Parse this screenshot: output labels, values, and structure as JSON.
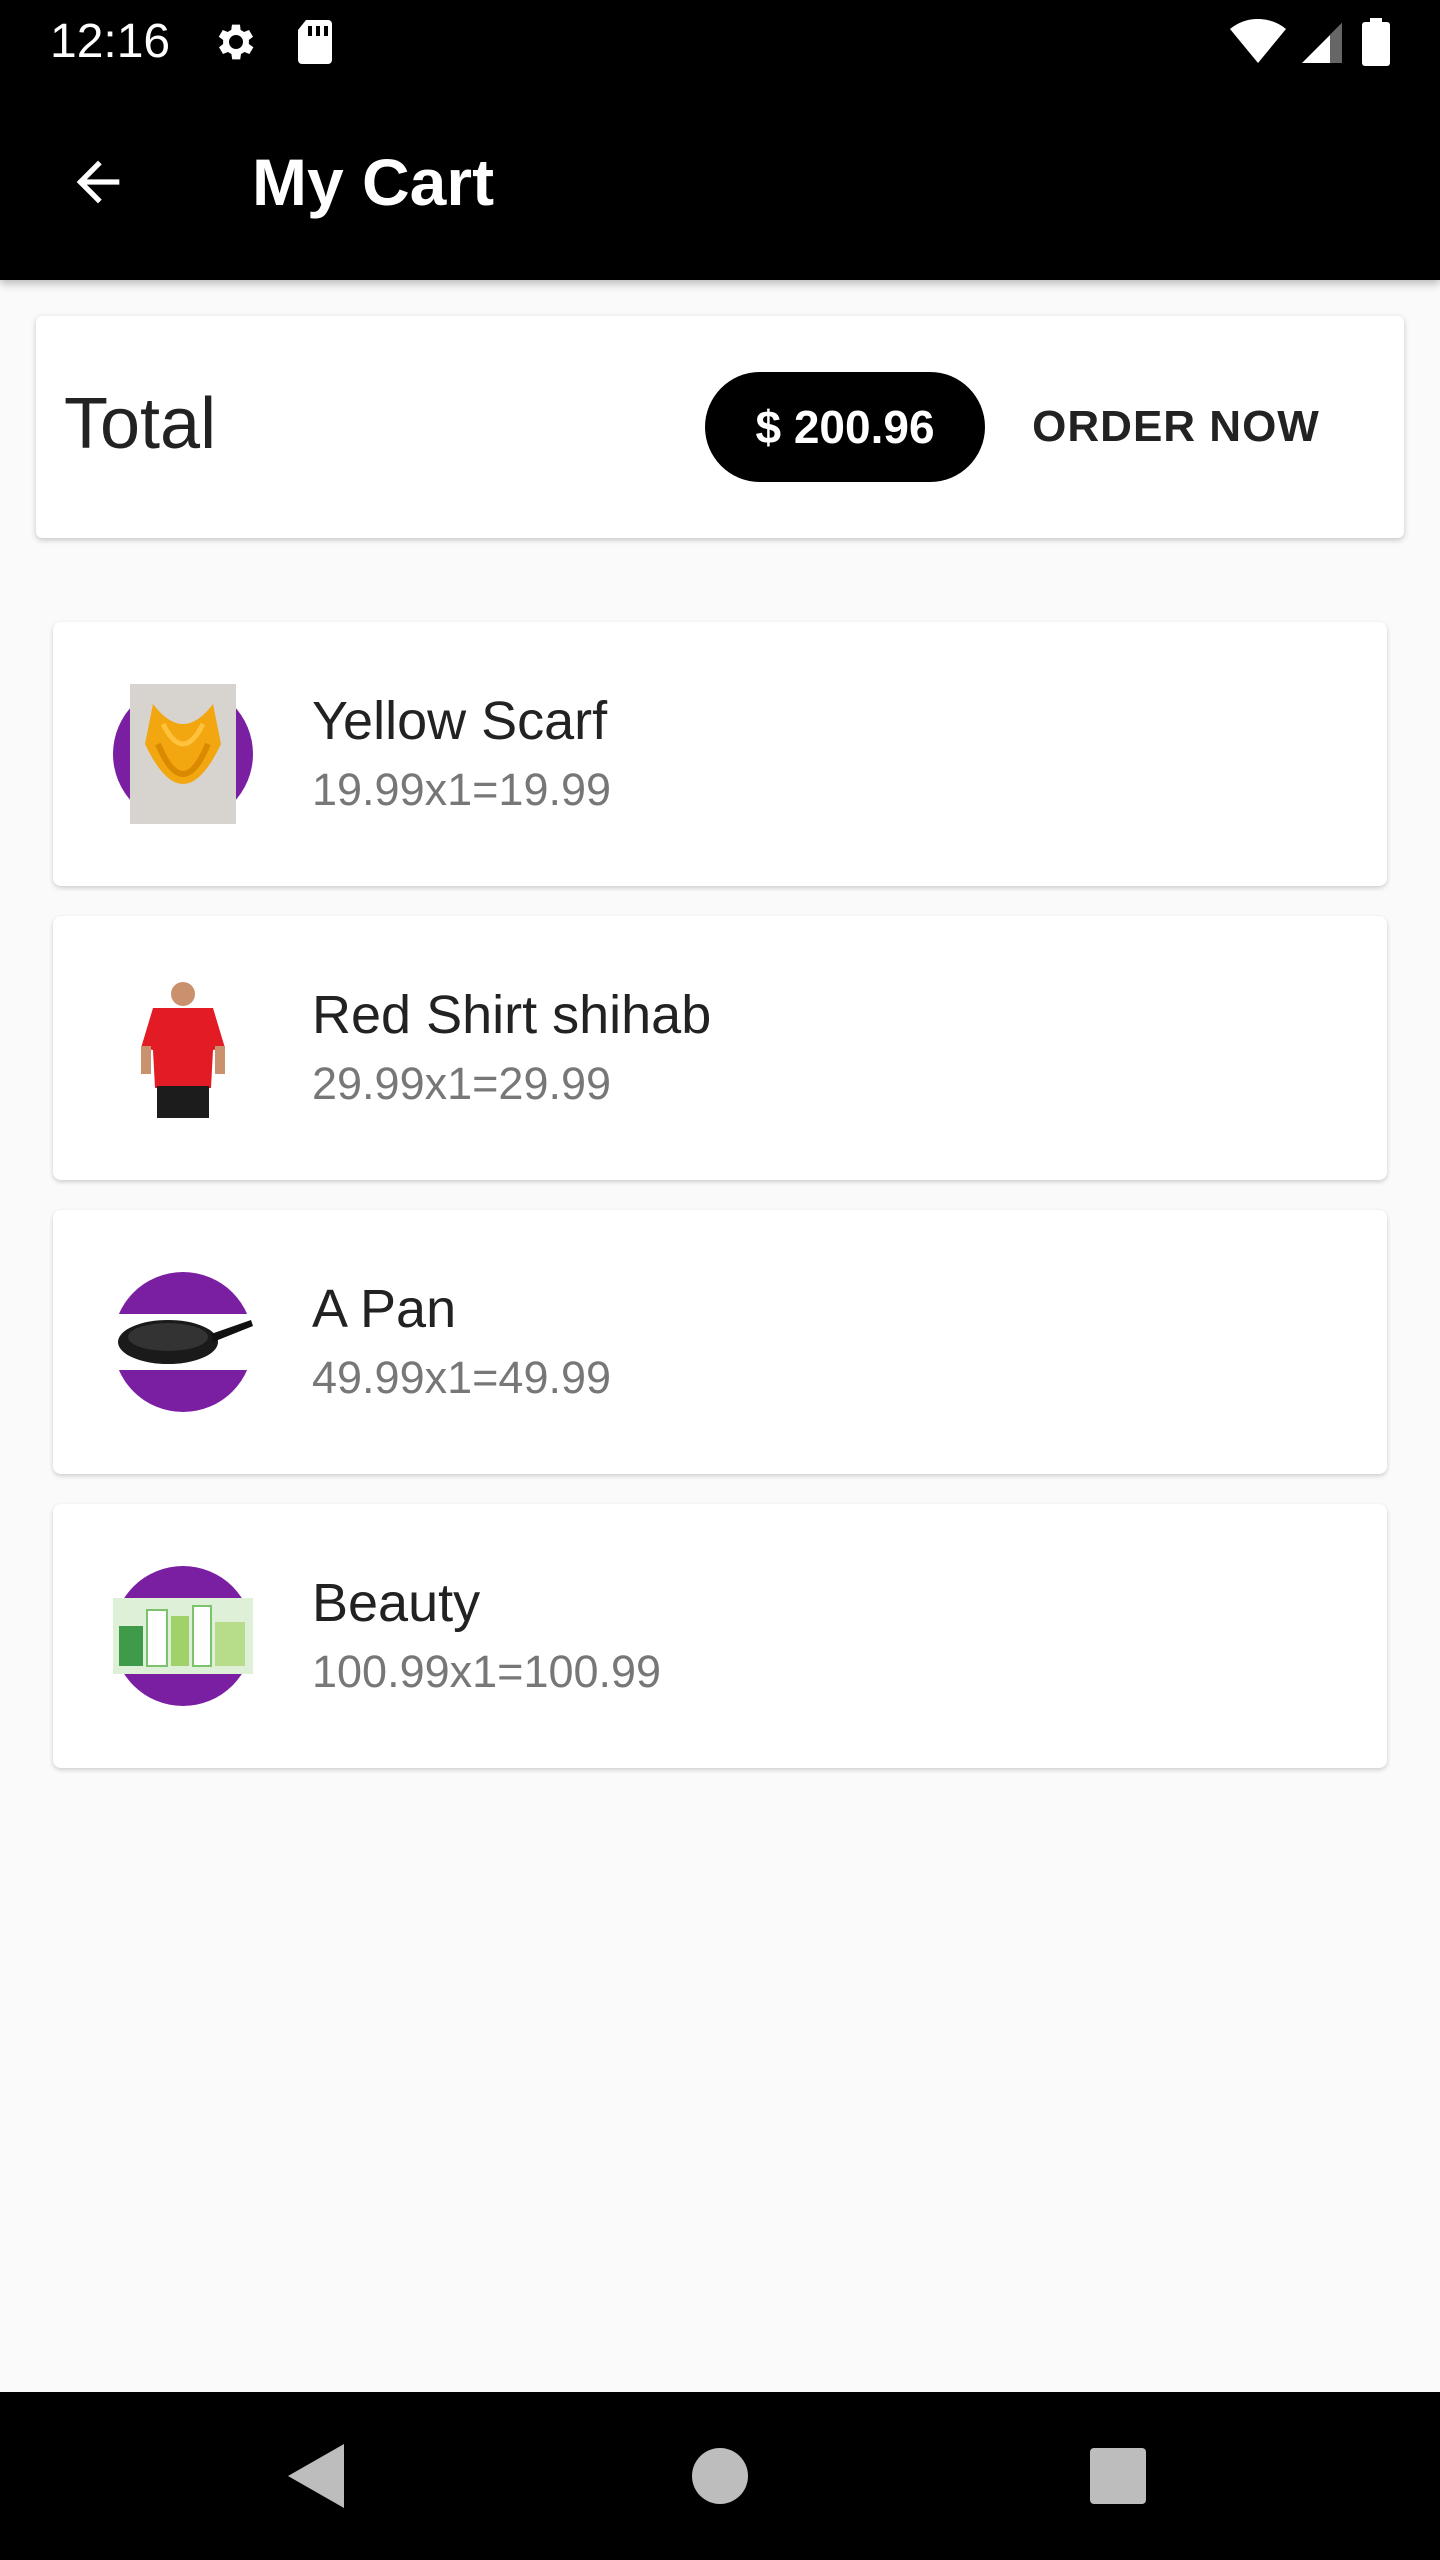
{
  "status_bar": {
    "time": "12:16",
    "icons": [
      "gear-icon",
      "sd-card-icon",
      "wifi-icon",
      "signal-icon",
      "battery-icon"
    ]
  },
  "app_bar": {
    "title": "My Cart",
    "back_icon": "arrow-left-icon"
  },
  "summary": {
    "total_label": "Total",
    "total_amount": "$ 200.96",
    "order_button": "ORDER NOW"
  },
  "cart_items": [
    {
      "title": "Yellow Scarf",
      "detail": "19.99x1=19.99",
      "image": "yellow-scarf-image"
    },
    {
      "title": "Red Shirt shihab",
      "detail": "29.99x1=29.99",
      "image": "red-shirt-image"
    },
    {
      "title": "A Pan",
      "detail": "49.99x1=49.99",
      "image": "pan-image"
    },
    {
      "title": "Beauty",
      "detail": "100.99x1=100.99",
      "image": "beauty-products-image"
    }
  ],
  "nav_bar": {
    "icons": [
      "back-triangle-icon",
      "home-circle-icon",
      "recents-square-icon"
    ]
  },
  "colors": {
    "app_bar": "#000000",
    "background": "#fafafa",
    "thumb_circle": "#7b1fa2",
    "chip": "#000000"
  }
}
